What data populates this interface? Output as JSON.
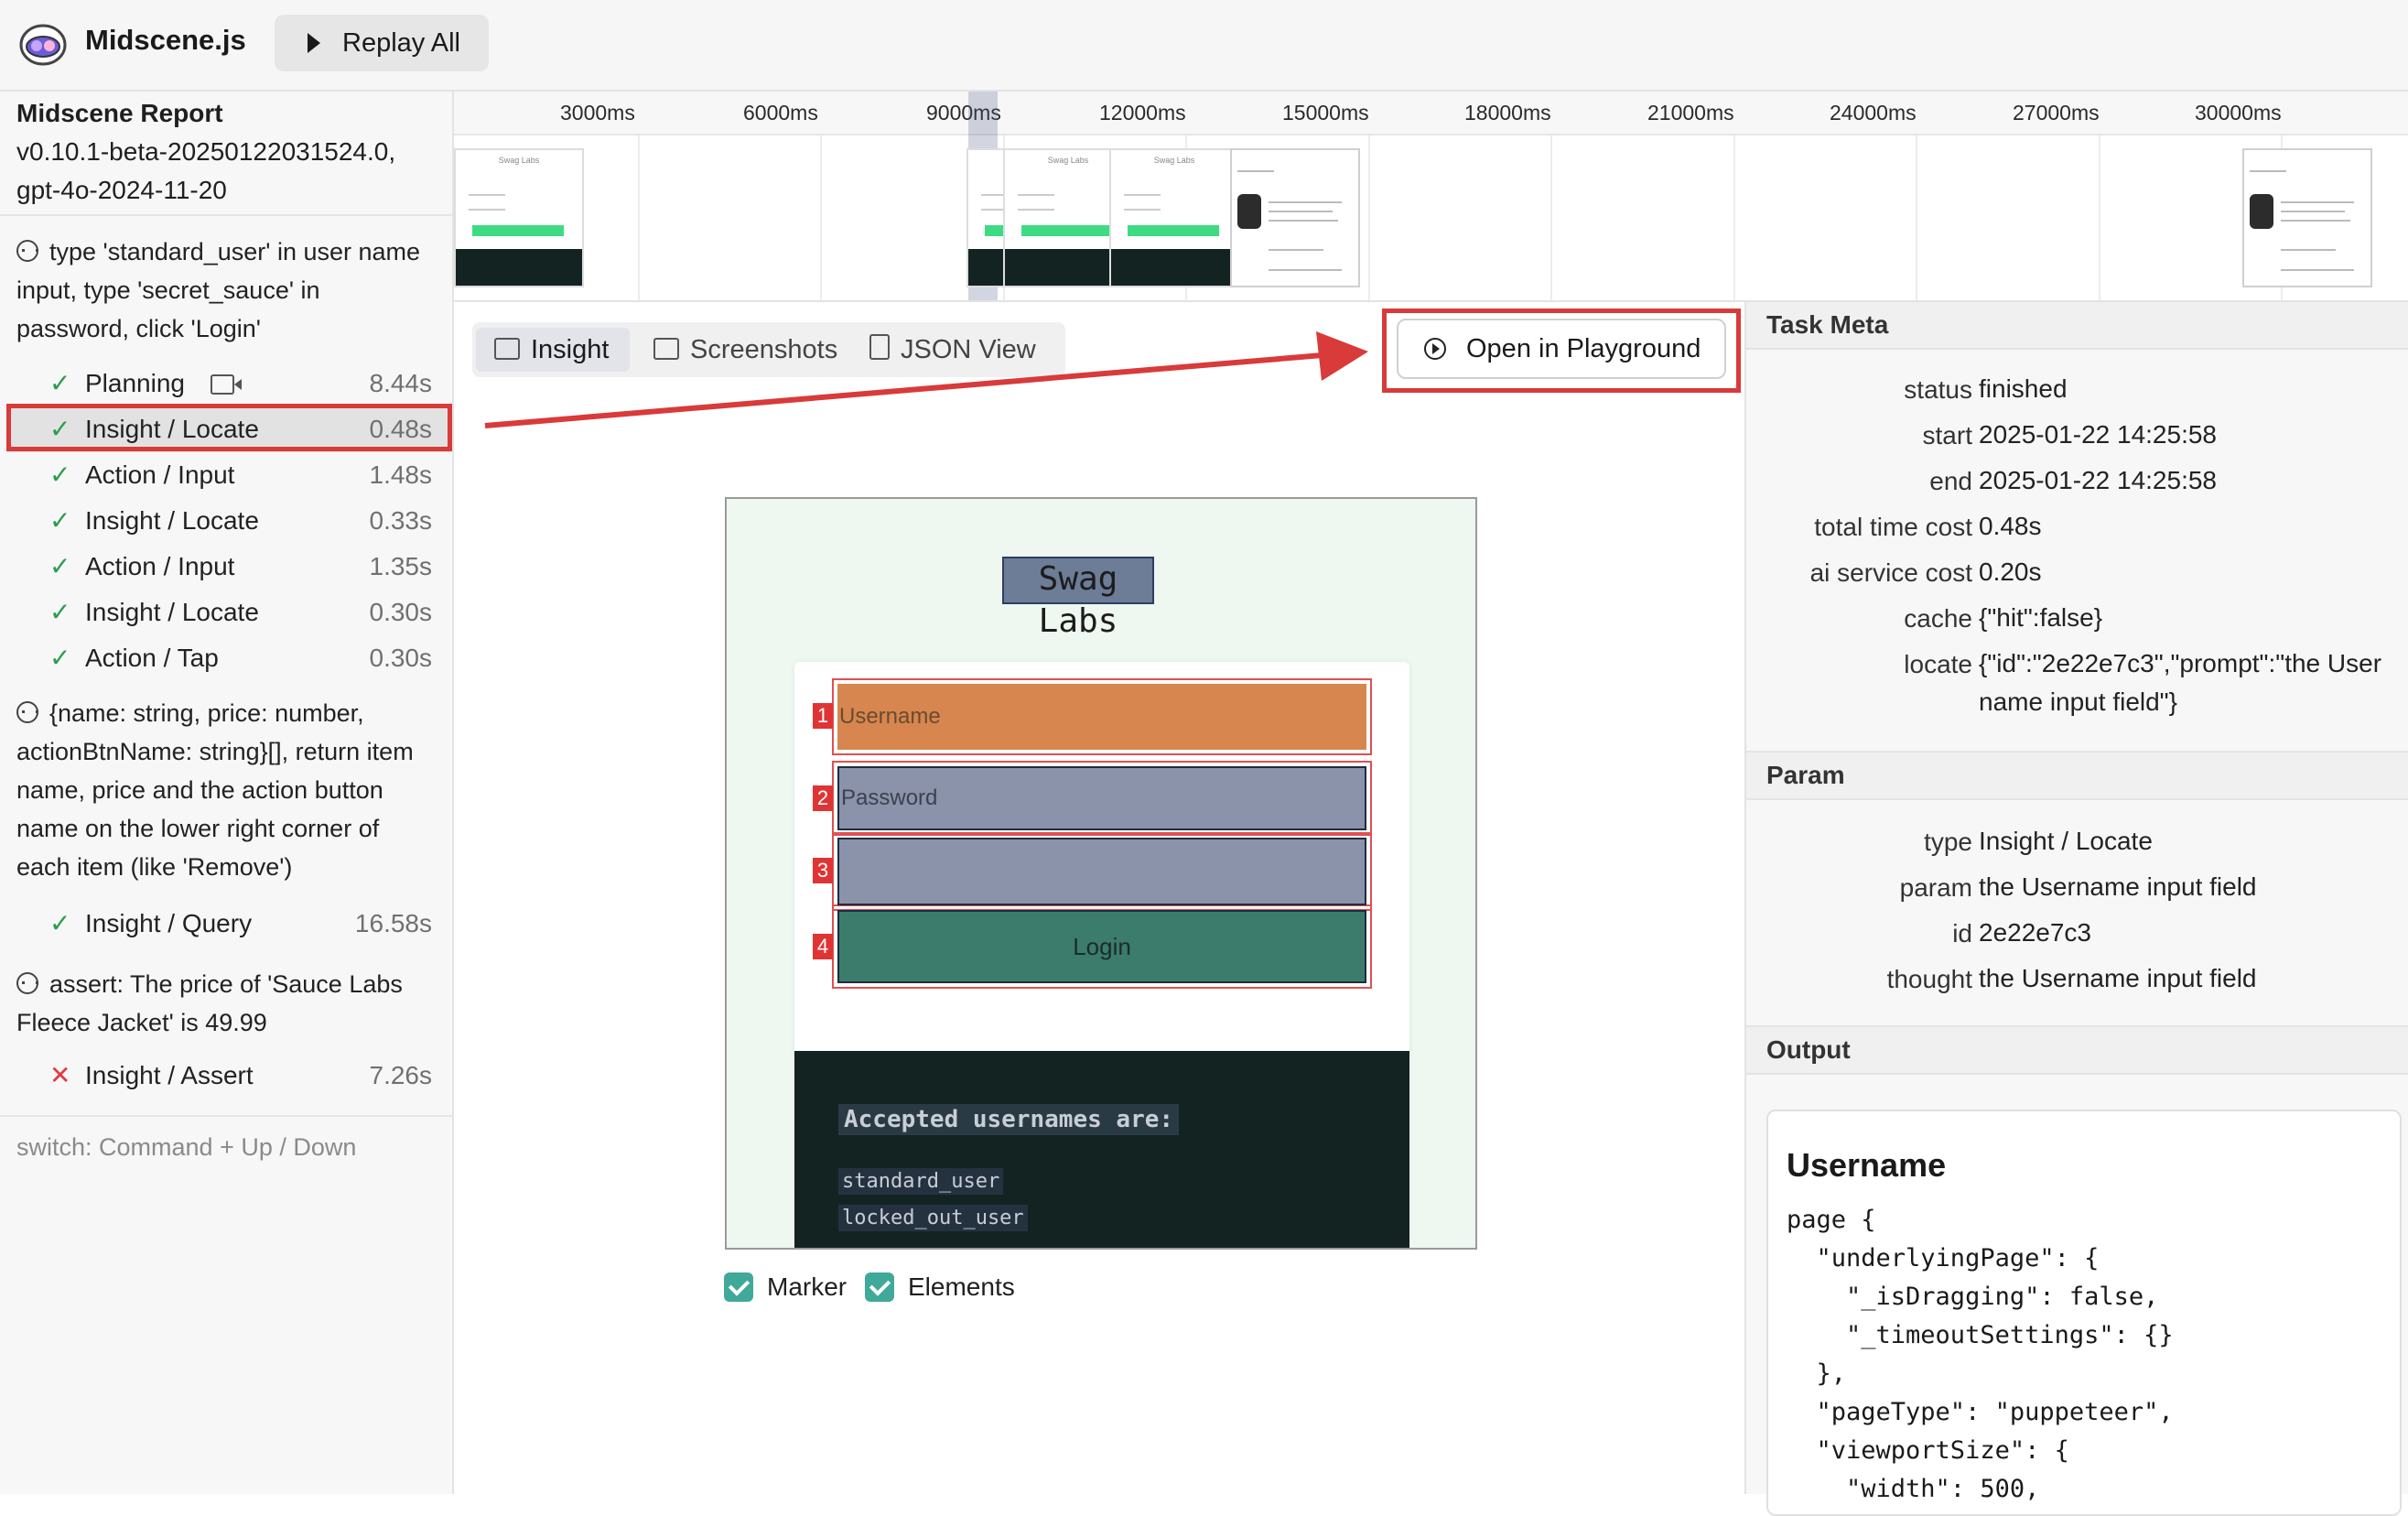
{
  "app": {
    "title": "Midscene.js",
    "replay_label": "Replay All"
  },
  "sidebar": {
    "report_title": "Midscene Report",
    "version": "v0.10.1-beta-20250122031524.0,",
    "model": "gpt-4o-2024-11-20",
    "groups": [
      {
        "title": "type 'standard_user' in user name input, type 'secret_sauce' in password, click 'Login'",
        "tasks": [
          {
            "label": "Planning",
            "duration": "8.44s",
            "status": "ok"
          },
          {
            "label": "Insight / Locate",
            "duration": "0.48s",
            "status": "ok"
          },
          {
            "label": "Action / Input",
            "duration": "1.48s",
            "status": "ok"
          },
          {
            "label": "Insight / Locate",
            "duration": "0.33s",
            "status": "ok"
          },
          {
            "label": "Action / Input",
            "duration": "1.35s",
            "status": "ok"
          },
          {
            "label": "Insight / Locate",
            "duration": "0.30s",
            "status": "ok"
          },
          {
            "label": "Action / Tap",
            "duration": "0.30s",
            "status": "ok"
          }
        ]
      },
      {
        "title": "{name: string, price: number, actionBtnName: string}[], return item name, price and the action button name on the lower right corner of each item (like 'Remove')",
        "tasks": [
          {
            "label": "Insight / Query",
            "duration": "16.58s",
            "status": "ok"
          }
        ]
      },
      {
        "title": "assert: The price of 'Sauce Labs Fleece Jacket' is 49.99",
        "tasks": [
          {
            "label": "Insight / Assert",
            "duration": "7.26s",
            "status": "error"
          }
        ]
      }
    ],
    "switch_hint": "switch: Command + Up / Down"
  },
  "timeline": {
    "ticks": [
      "3000ms",
      "6000ms",
      "9000ms",
      "12000ms",
      "15000ms",
      "18000ms",
      "21000ms",
      "24000ms",
      "27000ms",
      "30000ms"
    ]
  },
  "tabs": [
    {
      "label": "Insight",
      "icon": "insight-icon",
      "active": true
    },
    {
      "label": "Screenshots",
      "icon": "camera-icon",
      "active": false
    },
    {
      "label": "JSON View",
      "icon": "file-icon",
      "active": false
    }
  ],
  "open_playground_label": "Open in Playground",
  "preview": {
    "title": "Swag Labs",
    "elements": [
      {
        "index": "1",
        "placeholder": "Username"
      },
      {
        "index": "2",
        "placeholder": "Password"
      },
      {
        "index": "3",
        "placeholder": ""
      },
      {
        "index": "4",
        "label": "Login"
      }
    ],
    "accepted_heading": "Accepted usernames are:",
    "usernames": [
      "standard_user",
      "locked_out_user"
    ]
  },
  "toggles": {
    "marker_label": "Marker",
    "marker_checked": true,
    "elements_label": "Elements",
    "elements_checked": true
  },
  "task_meta": {
    "heading": "Task Meta",
    "rows": [
      {
        "key": "status",
        "value": "finished"
      },
      {
        "key": "start",
        "value": "2025-01-22 14:25:58"
      },
      {
        "key": "end",
        "value": "2025-01-22 14:25:58"
      },
      {
        "key": "total time cost",
        "value": "0.48s"
      },
      {
        "key": "ai service cost",
        "value": "0.20s"
      },
      {
        "key": "cache",
        "value": "{\"hit\":false}"
      },
      {
        "key": "locate",
        "value": "{\"id\":\"2e22e7c3\",\"prompt\":\"the Username input field\"}"
      }
    ]
  },
  "param": {
    "heading": "Param",
    "rows": [
      {
        "key": "type",
        "value": "Insight / Locate"
      },
      {
        "key": "param",
        "value": "the Username input field"
      },
      {
        "key": "id",
        "value": "2e22e7c3"
      },
      {
        "key": "thought",
        "value": "the Username input field"
      }
    ]
  },
  "output": {
    "heading": "Output",
    "title": "Username",
    "code": "page {\n  \"underlyingPage\": {\n    \"_isDragging\": false,\n    \"_timeoutSettings\": {}\n  },\n  \"pageType\": \"puppeteer\",\n  \"viewportSize\": {\n    \"width\": 500,"
  },
  "colors": {
    "highlight_red": "#d93a3a",
    "success_green": "#2a9d4b",
    "error_red": "#e03b3b",
    "checkbox_teal": "#3fa99a"
  }
}
